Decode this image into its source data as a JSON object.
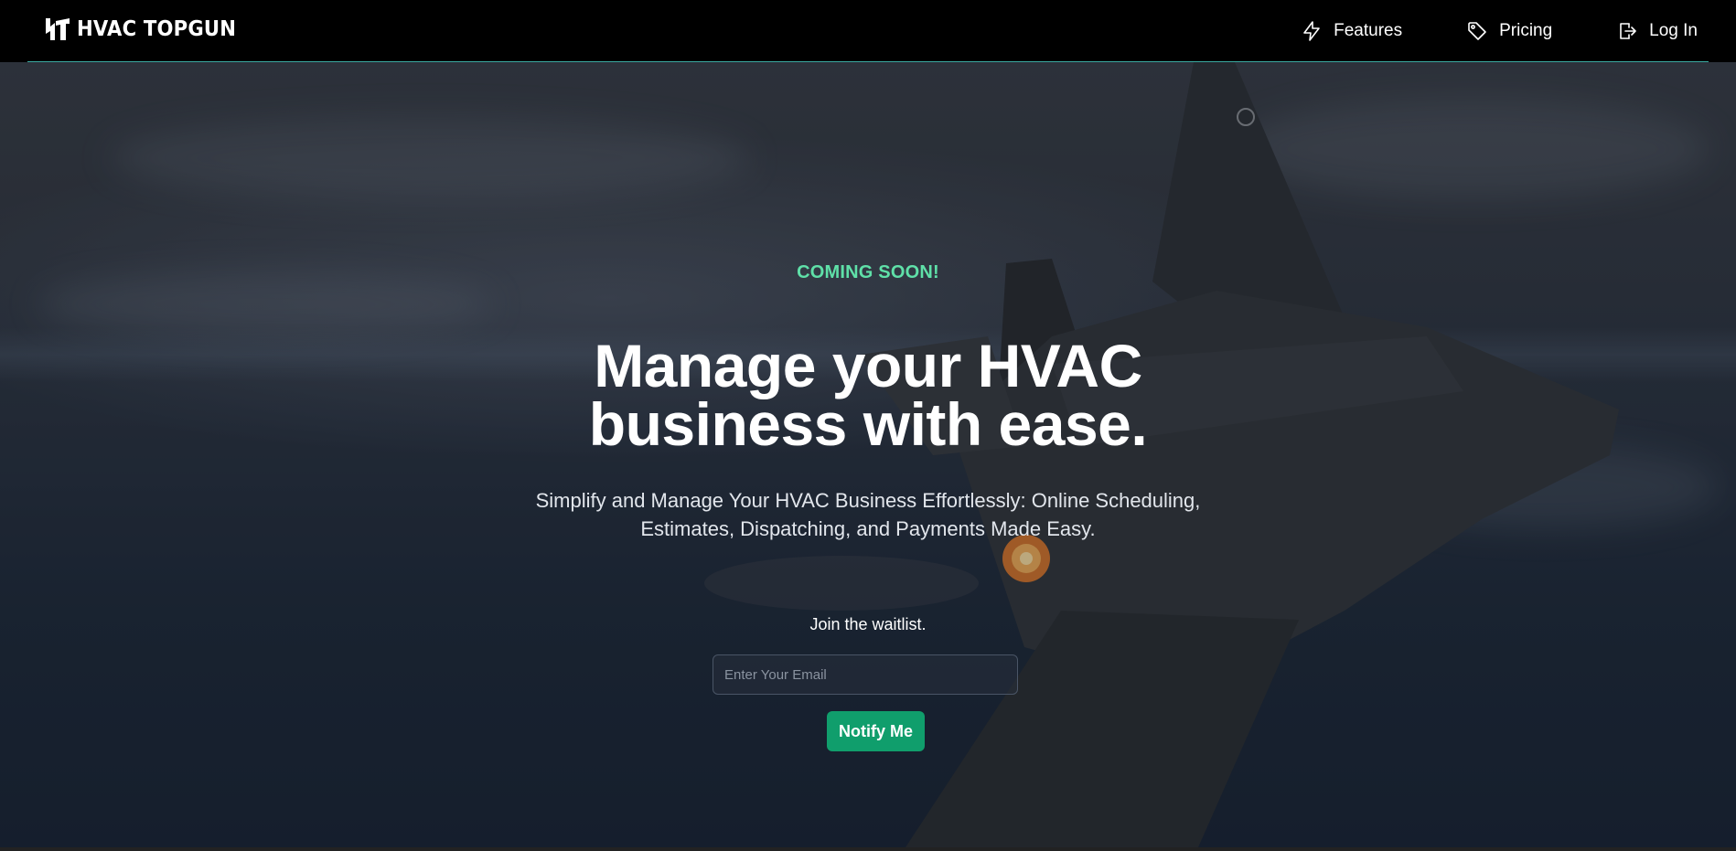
{
  "brand": {
    "name": "HVAC TOPGUN",
    "logo_icon": "ht-monogram-logo"
  },
  "nav": {
    "items": [
      {
        "label": "Features",
        "icon": "lightning-bolt-icon"
      },
      {
        "label": "Pricing",
        "icon": "price-tag-icon"
      },
      {
        "label": "Log In",
        "icon": "log-in-door-icon"
      }
    ]
  },
  "hero": {
    "eyebrow": "COMING SOON!",
    "headline_line1": "Manage your HVAC",
    "headline_line2": "business with ease.",
    "subtitle_line1": "Simplify and Manage Your HVAC Business Effortlessly: Online Scheduling,",
    "subtitle_line2": "Estimates, Dispatching, and Payments Made Easy.",
    "background": "fighter-jet-over-clouds-photo"
  },
  "waitlist": {
    "label": "Join the waitlist.",
    "email_placeholder": "Enter Your Email",
    "email_value": "",
    "button_label": "Notify Me"
  },
  "colors": {
    "accent_green": "#109e6c",
    "eyebrow_green": "#5fe0a8",
    "nav_rule": "#3aa9a0"
  }
}
